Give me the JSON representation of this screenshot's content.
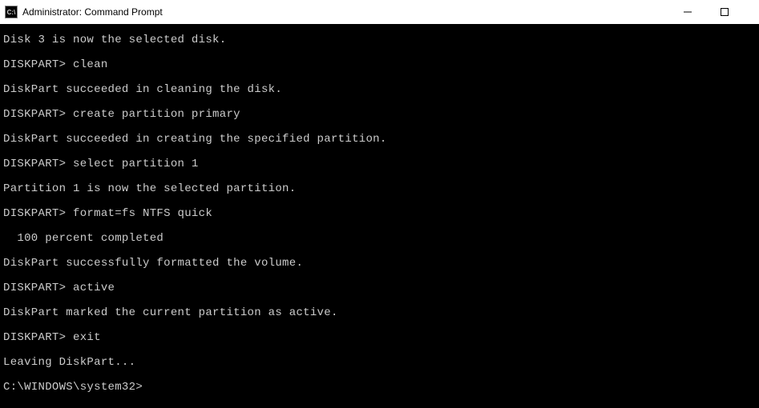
{
  "window": {
    "title": "Administrator: Command Prompt"
  },
  "terminal": {
    "lines": [
      "Disk 3 is now the selected disk.",
      "DISKPART> clean",
      "DiskPart succeeded in cleaning the disk.",
      "DISKPART> create partition primary",
      "DiskPart succeeded in creating the specified partition.",
      "DISKPART> select partition 1",
      "Partition 1 is now the selected partition.",
      "DISKPART> format=fs NTFS quick",
      "  100 percent completed",
      "DiskPart successfully formatted the volume.",
      "DISKPART> active",
      "DiskPart marked the current partition as active.",
      "DISKPART> exit",
      "Leaving DiskPart...",
      "C:\\WINDOWS\\system32>"
    ]
  }
}
